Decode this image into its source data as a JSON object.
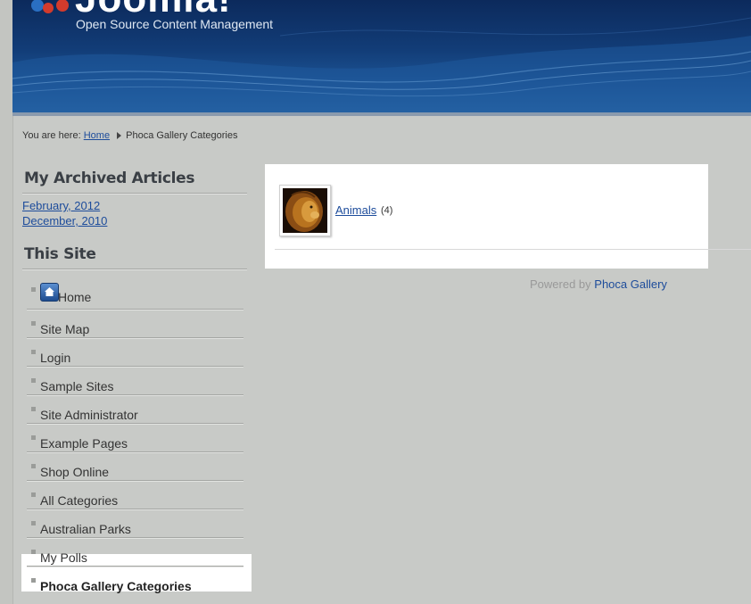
{
  "header": {
    "site_name": "Joomla!",
    "tagline": "Open Source Content Management"
  },
  "breadcrumb": {
    "prefix": "You are here:",
    "home": "Home",
    "current": "Phoca Gallery Categories"
  },
  "archive": {
    "title": "My Archived Articles",
    "items": [
      "February, 2012",
      "December, 2010"
    ]
  },
  "this_site": {
    "title": "This Site",
    "items": [
      {
        "label": "Home",
        "icon": "home-icon"
      },
      {
        "label": "Site Map"
      },
      {
        "label": "Login"
      },
      {
        "label": "Sample Sites"
      },
      {
        "label": "Site Administrator"
      },
      {
        "label": "Example Pages"
      },
      {
        "label": "Shop Online"
      },
      {
        "label": "All Categories"
      },
      {
        "label": "Australian Parks"
      },
      {
        "label": "My Polls"
      },
      {
        "label": "Phoca Gallery Categories",
        "active": true
      }
    ]
  },
  "gallery": {
    "category_name": "Animals",
    "category_count": "(4)",
    "thumbnail": "lion-thumbnail"
  },
  "footer": {
    "powered_prefix": "Powered by",
    "powered_link": "Phoca Gallery"
  },
  "colors": {
    "link": "#1d4c9b",
    "page_bg": "#c8cac7",
    "header_dark": "#0c2a5c"
  }
}
